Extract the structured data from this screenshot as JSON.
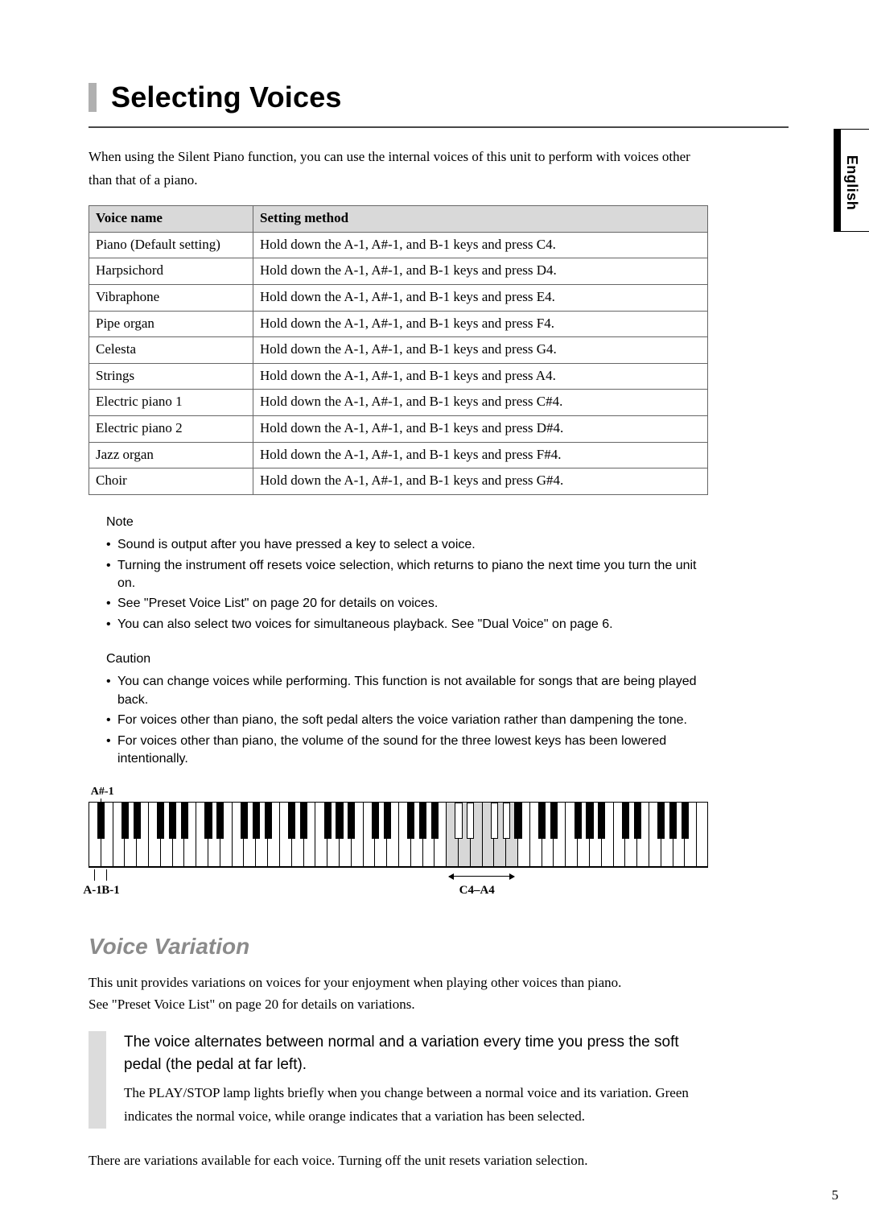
{
  "lang_tab": "English",
  "h1": "Selecting Voices",
  "intro": "When using the Silent Piano function, you can use the internal voices of this unit to perform with voices other than that of a piano.",
  "table": {
    "headers": {
      "col1": "Voice name",
      "col2": "Setting method"
    },
    "rows": [
      {
        "name": "Piano (Default setting)",
        "method": "Hold down the A-1, A#-1, and B-1 keys and press C4."
      },
      {
        "name": "Harpsichord",
        "method": "Hold down the A-1, A#-1, and B-1 keys and press D4."
      },
      {
        "name": "Vibraphone",
        "method": "Hold down the A-1, A#-1, and B-1 keys and press E4."
      },
      {
        "name": "Pipe organ",
        "method": "Hold down the A-1, A#-1, and B-1 keys and press F4."
      },
      {
        "name": "Celesta",
        "method": "Hold down the A-1, A#-1, and B-1 keys and press G4."
      },
      {
        "name": "Strings",
        "method": "Hold down the A-1, A#-1, and B-1 keys and press A4."
      },
      {
        "name": "Electric piano 1",
        "method": "Hold down the A-1, A#-1, and B-1 keys and press C#4."
      },
      {
        "name": "Electric piano 2",
        "method": "Hold down the A-1, A#-1, and B-1 keys and press D#4."
      },
      {
        "name": "Jazz organ",
        "method": "Hold down the A-1, A#-1, and B-1 keys and press F#4."
      },
      {
        "name": "Choir",
        "method": "Hold down the A-1, A#-1, and B-1 keys and press G#4."
      }
    ]
  },
  "note": {
    "title": "Note",
    "items": [
      "Sound is output after you have pressed a key to select a voice.",
      "Turning the instrument off resets voice selection, which returns to piano the next time you turn the unit on.",
      "See \"Preset Voice List\" on page 20 for details on voices.",
      "You can also select two voices for simultaneous playback. See \"Dual Voice\" on page 6."
    ]
  },
  "caution": {
    "title": "Caution",
    "items": [
      "You can change voices while performing. This function is not available for songs that are being played back.",
      "For voices other than piano, the soft pedal alters the voice variation rather than dampening the tone.",
      "For voices other than piano, the volume of the sound for the three lowest keys has been lowered intentionally."
    ]
  },
  "kbd_labels": {
    "top_asharp": "A#-1",
    "bottom_a": "A-1",
    "bottom_b": "B-1",
    "range": "C4–A4"
  },
  "h2": "Voice Variation",
  "variation_intro_1": "This unit provides variations on voices for your enjoyment when playing other voices than piano.",
  "variation_intro_2": "See \"Preset Voice List\" on page 20 for details on variations.",
  "box": {
    "title": "The voice alternates between normal and a variation every time you press the soft pedal (the pedal at far left).",
    "text": "The PLAY/STOP lamp lights briefly when you change between a normal voice and its variation. Green indicates the normal voice, while orange indicates that a variation has been selected."
  },
  "closing": "There are variations available for each voice. Turning off the unit resets variation selection.",
  "page_no": "5"
}
